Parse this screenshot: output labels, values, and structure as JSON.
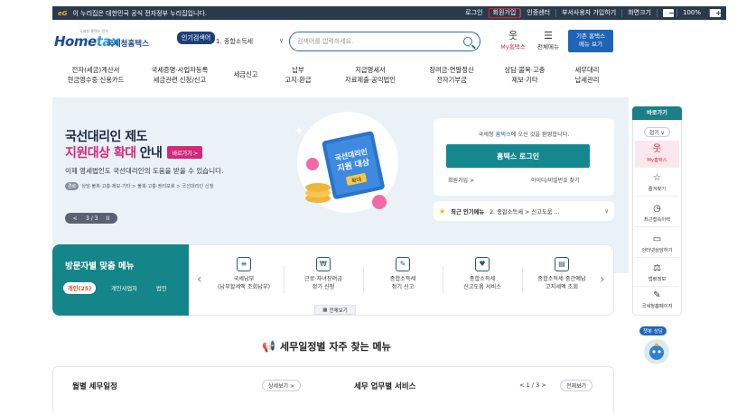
{
  "govbar": {
    "logo": "eG",
    "notice": "이 누리집은 대한민국 공식 전자정부 누리집입니다.",
    "links": [
      "로그인",
      "회원가입",
      "인증센터",
      "부서사용자 가입하기",
      "화면크기"
    ],
    "zoom_minus": "−",
    "zoom": "100%",
    "zoom_plus": "+"
  },
  "header": {
    "logo_sub": "국세청 홈택스 전자",
    "logo_home": "Home",
    "logo_tax": "tax",
    "logo_kor": "국세청홈택스",
    "popular_tag": "인기검색어",
    "search_select": "1. 종합소득세",
    "search_placeholder": "검색어를 입력하세요.",
    "my_hometax": "My홈택스",
    "all_menu": "전체메뉴",
    "basic_btn_l1": "기존 홈택스",
    "basic_btn_l2": "메뉴 보기"
  },
  "nav": [
    "전자(세금)계산서\n현금영수증·신용카드",
    "국세증명·사업자등록\n세금관련 신청/신고",
    "세금신고",
    "납부\n고지·환급",
    "지급명세서\n자료제출·공익법인",
    "장려금·연말정산\n전자기부금",
    "상담·불복·고충\n제보·기타",
    "세무대리\n납세관리"
  ],
  "hero": {
    "title1": "국선대리인 제도",
    "title2_pink": "지원대상 확대",
    "title2_dark": "안내",
    "go_label": "바로가기 >",
    "desc": "이제 영세법인도 국선대리인의 도움을 받을 수 있습니다.",
    "path_tag": "경로",
    "path": "상담·불복·고충·제보·기타 > 불복·고충·권리보호 > 국선대리인 신청",
    "pager": "3 / 3",
    "book_line1": "국선대리인",
    "book_line2": "지원 대상",
    "book_badge": "확대"
  },
  "login": {
    "welcome_pre": "국세청",
    "welcome_brand": "홈택스",
    "welcome_post": "에 오신 것을 환영합니다.",
    "button": "홈택스 로그인",
    "join": "회원가입 >",
    "find": "아이디/비밀번호 찾기"
  },
  "popular_menu": {
    "label": "최근 인기메뉴",
    "value": "2. 종합소득세 > 신고도움 ..."
  },
  "visitor": {
    "title": "방문자별 맞춤 메뉴",
    "tabs": [
      "개인(25)",
      "개인사업자",
      "법인"
    ],
    "services": [
      {
        "icon": "≡",
        "l1": "국세납부",
        "l2": "(납부할세액 조회납부)"
      },
      {
        "icon": "₩",
        "l1": "근로·자녀장려금",
        "l2": "정기 신청"
      },
      {
        "icon": "✎",
        "l1": "종합소득세",
        "l2": "정기 신고"
      },
      {
        "icon": "♥",
        "l1": "종합소득세",
        "l2": "신고도움 서비스"
      },
      {
        "icon": "▤",
        "l1": "종합소득세 중간예납",
        "l2": "고지세액 조회"
      }
    ],
    "view_all": "전체보기"
  },
  "section": {
    "title": "세무일정별 자주 찾는 메뉴"
  },
  "bottom": {
    "monthly": "월별 세무일정",
    "monthly_more": "상세보기 >",
    "tax_service": "세무 업무별 서비스",
    "tax_pager": "1 / 3",
    "tax_all": "전체보기"
  },
  "quick": {
    "head": "바로가기",
    "fold": "접기 ∨",
    "items": [
      {
        "icon": "웃",
        "label": "My홈택스"
      },
      {
        "icon": "☆",
        "label": "즐겨찾기"
      },
      {
        "icon": "◷",
        "label": "최근접속이력"
      },
      {
        "icon": "▭",
        "label": "인터넷상담하기"
      },
      {
        "icon": "⚖",
        "label": "법령정보"
      },
      {
        "icon": "✎",
        "label": "국세청홈페이지"
      }
    ],
    "chatbot": "챗봇 상담"
  }
}
